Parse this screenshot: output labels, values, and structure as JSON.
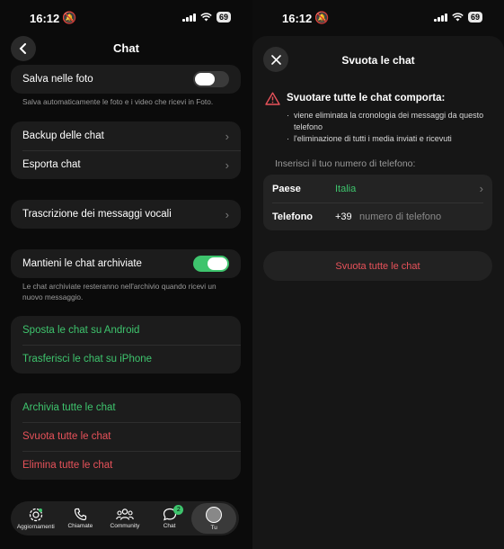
{
  "status": {
    "time": "16:12",
    "battery": "69"
  },
  "left": {
    "title": "Chat",
    "save_photos": {
      "label": "Salva nelle foto",
      "toggle": "off",
      "note": "Salva automaticamente le foto e i video che ricevi in Foto."
    },
    "backup_group": [
      "Backup delle chat",
      "Esporta chat"
    ],
    "transcription": "Trascrizione dei messaggi vocali",
    "keep_archived": {
      "label": "Mantieni le chat archiviate",
      "toggle": "on",
      "note": "Le chat archiviate resteranno nell'archivio quando ricevi un nuovo messaggio."
    },
    "transfer": [
      "Sposta le chat su Android",
      "Trasferisci le chat su iPhone"
    ],
    "danger": [
      "Archivia tutte le chat",
      "Svuota tutte le chat",
      "Elimina tutte le chat"
    ],
    "tabs": [
      {
        "label": "Aggiornamenti",
        "icon": "updates-icon"
      },
      {
        "label": "Chiamate",
        "icon": "phone-icon"
      },
      {
        "label": "Community",
        "icon": "community-icon"
      },
      {
        "label": "Chat",
        "icon": "chat-icon",
        "badge": "2"
      },
      {
        "label": "Tu",
        "icon": "avatar-icon"
      }
    ],
    "accent": "#3ec46d",
    "danger_color": "#e8525a"
  },
  "right": {
    "title": "Svuota le chat",
    "warning_title": "Svuotare tutte le chat comporta:",
    "warning_items": [
      "viene eliminata la cronologia dei messaggi da questo telefono",
      "l'eliminazione di tutti i media inviati e ricevuti"
    ],
    "phone_label": "Inserisci il tuo numero di telefono:",
    "country_key": "Paese",
    "country_value": "Italia",
    "phone_key": "Telefono",
    "phone_prefix": "+39",
    "phone_placeholder": "numero di telefono",
    "action": "Svuota tutte le chat"
  }
}
